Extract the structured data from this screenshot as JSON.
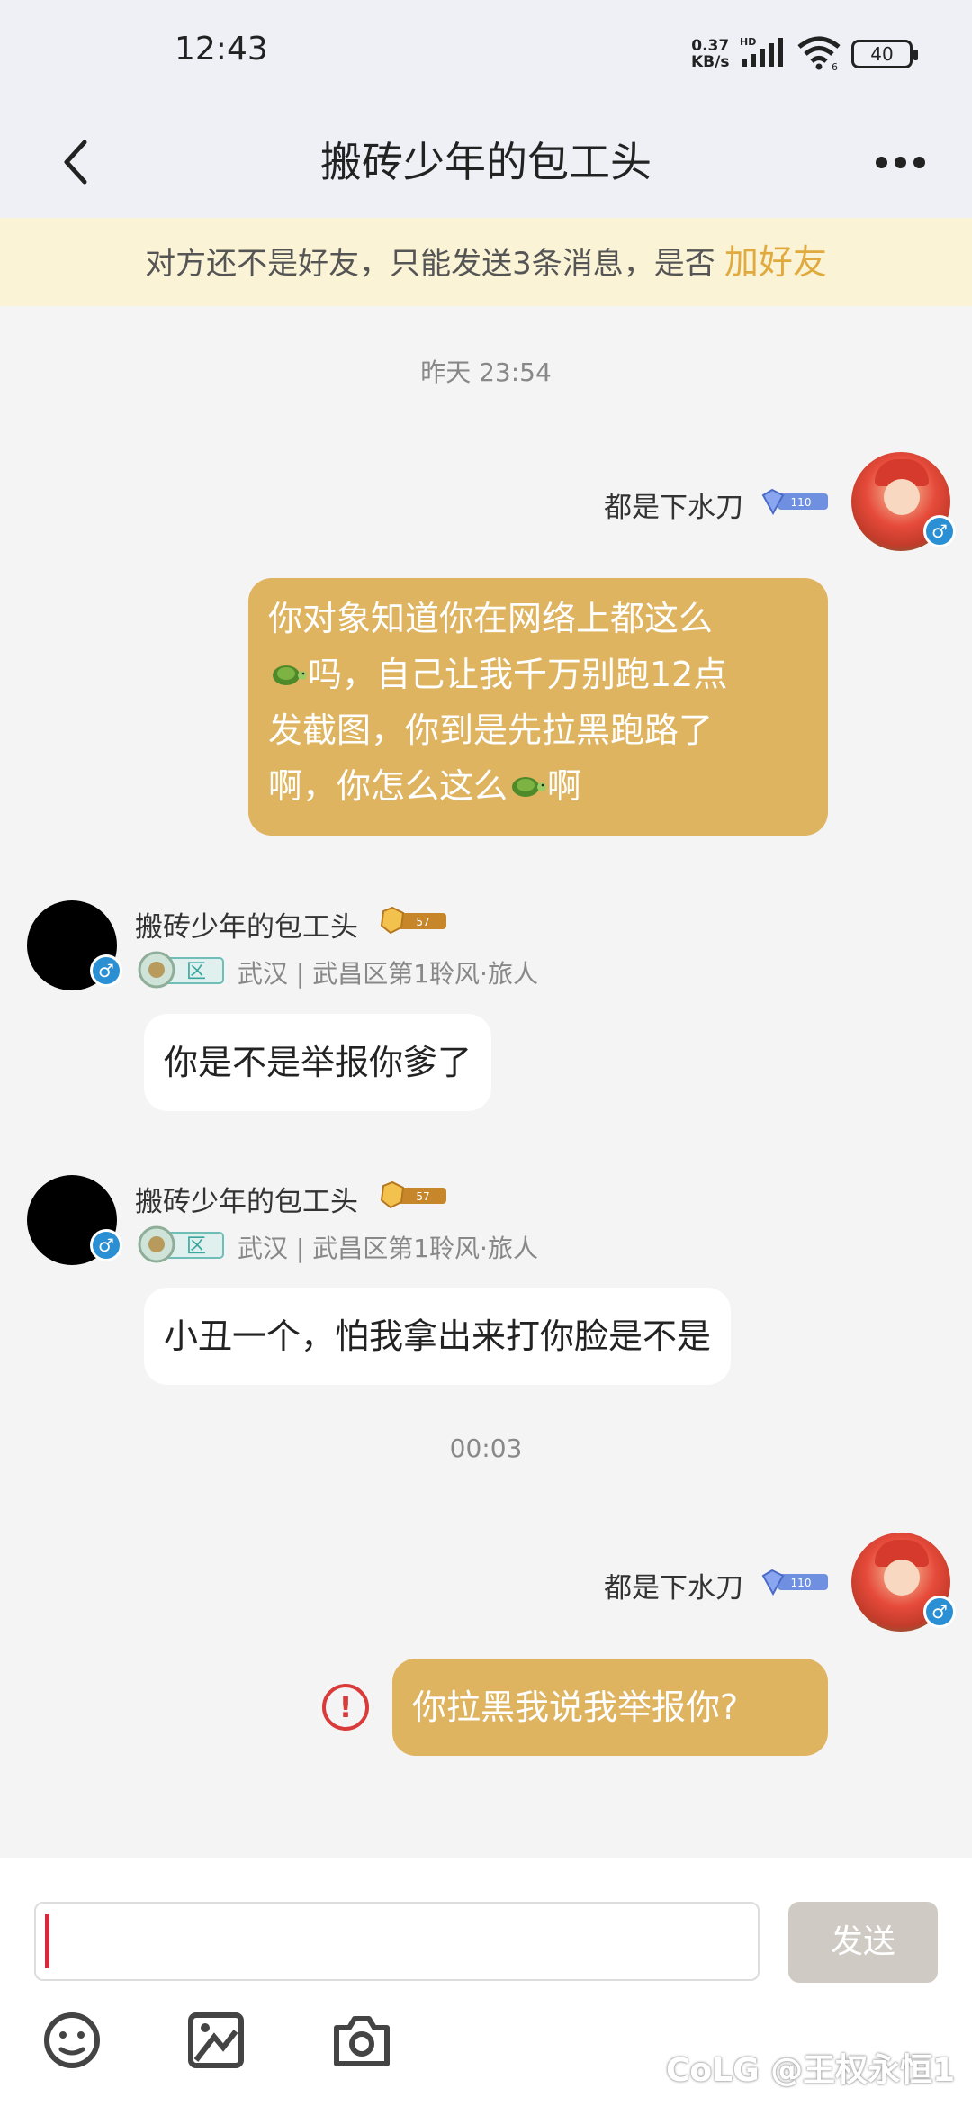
{
  "status_bar": {
    "time": "12:43",
    "net_speed_value": "0.37",
    "net_speed_unit": "KB/s",
    "battery": "40"
  },
  "header": {
    "title": "搬砖少年的包工头"
  },
  "notice": {
    "text": "对方还不是好友，只能发送3条消息，是否",
    "link": "加好友"
  },
  "conversation": {
    "timestamp_1": "昨天   23:54",
    "message_1": {
      "sender": "都是下水刀",
      "lines": [
        "你对象知道你在网络上都这么",
        "吗，自己让我千万别跑12点",
        "发截图，你到是先拉黑跑路了",
        "啊，你怎么这么",
        "啊"
      ]
    },
    "message_2": {
      "sender": "搬砖少年的包工头",
      "rank_label": "区",
      "location": "武汉 | 武昌区第1聆风·旅人",
      "text": "你是不是举报你爹了"
    },
    "message_3": {
      "sender": "搬砖少年的包工头",
      "rank_label": "区",
      "location": "武汉 | 武昌区第1聆风·旅人",
      "text": "小丑一个，怕我拿出来打你脸是不是"
    },
    "timestamp_2": "00:03",
    "message_4": {
      "sender": "都是下水刀",
      "text": "你拉黑我说我举报你?",
      "status": "failed"
    }
  },
  "input_bar": {
    "send_label": "发送",
    "tools": [
      "emoji-icon",
      "image-icon",
      "camera-icon"
    ]
  },
  "watermark": "CoLG @王权永恒1",
  "colors": {
    "accent_gold": "#dfb460",
    "link_gold": "#e0aa3e",
    "error_red": "#d93a3a",
    "header_bg": "#eef0f6"
  }
}
